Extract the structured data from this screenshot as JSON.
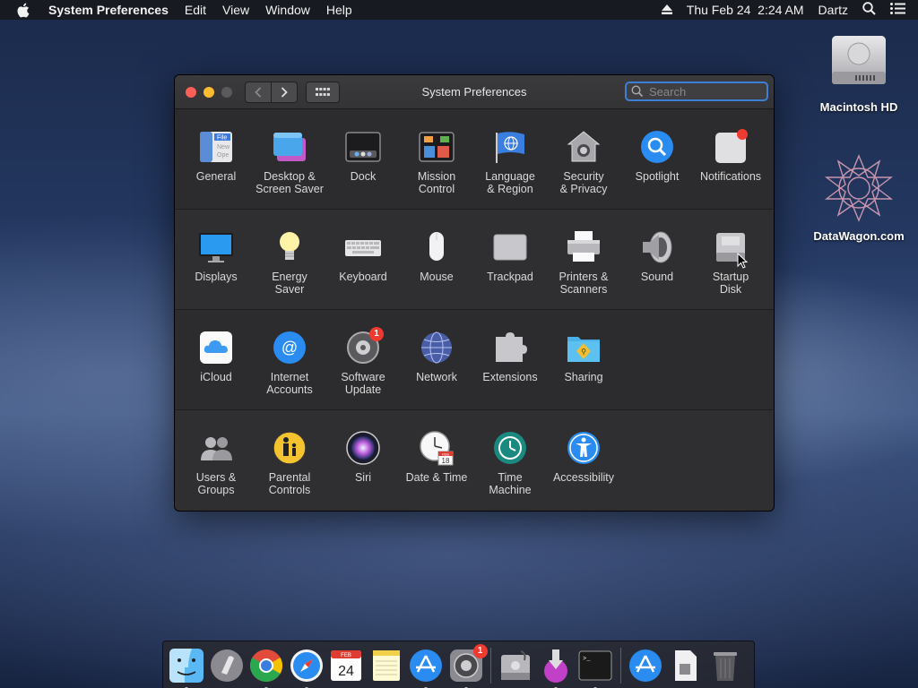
{
  "menubar": {
    "app_name": "System Preferences",
    "menus": [
      "Edit",
      "View",
      "Window",
      "Help"
    ],
    "clock": "Thu Feb 24  2:24 AM",
    "user": "Dartz"
  },
  "desktop": {
    "icons": [
      {
        "label": "Macintosh HD",
        "icon": "hard-drive-icon"
      },
      {
        "label": "DataWagon.com",
        "icon": "geometric-star-icon"
      }
    ]
  },
  "window": {
    "title": "System Preferences",
    "search_placeholder": "Search",
    "sections": [
      [
        {
          "label": "General",
          "icon": "general-icon"
        },
        {
          "label": "Desktop &\nScreen Saver",
          "icon": "desktop-screensaver-icon"
        },
        {
          "label": "Dock",
          "icon": "dock-icon"
        },
        {
          "label": "Mission\nControl",
          "icon": "mission-control-icon"
        },
        {
          "label": "Language\n& Region",
          "icon": "language-region-icon"
        },
        {
          "label": "Security\n& Privacy",
          "icon": "security-privacy-icon"
        },
        {
          "label": "Spotlight",
          "icon": "spotlight-icon"
        },
        {
          "label": "Notifications",
          "icon": "notifications-icon"
        }
      ],
      [
        {
          "label": "Displays",
          "icon": "displays-icon"
        },
        {
          "label": "Energy\nSaver",
          "icon": "energy-saver-icon"
        },
        {
          "label": "Keyboard",
          "icon": "keyboard-icon"
        },
        {
          "label": "Mouse",
          "icon": "mouse-icon"
        },
        {
          "label": "Trackpad",
          "icon": "trackpad-icon"
        },
        {
          "label": "Printers &\nScanners",
          "icon": "printer-icon"
        },
        {
          "label": "Sound",
          "icon": "sound-icon"
        },
        {
          "label": "Startup\nDisk",
          "icon": "startup-disk-icon"
        }
      ],
      [
        {
          "label": "iCloud",
          "icon": "icloud-icon"
        },
        {
          "label": "Internet\nAccounts",
          "icon": "internet-accounts-icon"
        },
        {
          "label": "Software\nUpdate",
          "icon": "software-update-icon",
          "badge": "1"
        },
        {
          "label": "Network",
          "icon": "network-icon"
        },
        {
          "label": "Extensions",
          "icon": "extensions-icon"
        },
        {
          "label": "Sharing",
          "icon": "sharing-icon"
        }
      ],
      [
        {
          "label": "Users &\nGroups",
          "icon": "users-groups-icon"
        },
        {
          "label": "Parental\nControls",
          "icon": "parental-controls-icon"
        },
        {
          "label": "Siri",
          "icon": "siri-icon"
        },
        {
          "label": "Date & Time",
          "icon": "date-time-icon"
        },
        {
          "label": "Time\nMachine",
          "icon": "time-machine-icon"
        },
        {
          "label": "Accessibility",
          "icon": "accessibility-icon"
        }
      ]
    ],
    "date_icon": {
      "month": "FEB",
      "day": "18"
    }
  },
  "dock": {
    "calendar": {
      "month": "FEB",
      "day": "24"
    },
    "prefs_badge": "1",
    "items": [
      "finder-icon",
      "launchpad-icon",
      "chrome-icon",
      "safari-icon",
      "calendar-icon",
      "notes-icon",
      "app-store-icon",
      "system-preferences-icon",
      "disk-utility-icon",
      "installer-icon",
      "terminal-icon",
      "app-store-downloads-icon",
      "document-icon",
      "trash-icon"
    ]
  }
}
